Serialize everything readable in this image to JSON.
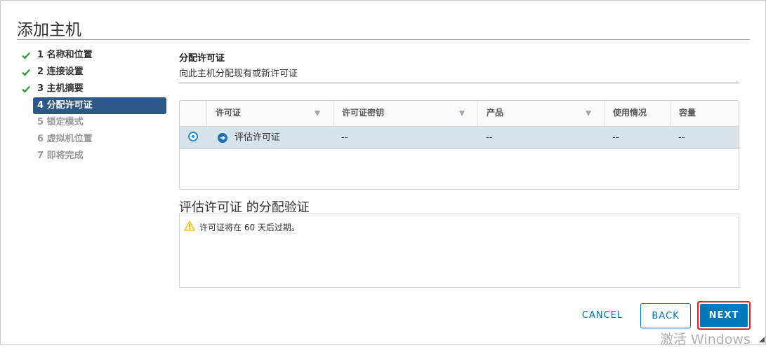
{
  "dialog": {
    "title": "添加主机"
  },
  "steps": [
    {
      "label": "1 名称和位置",
      "state": "done"
    },
    {
      "label": "2 连接设置",
      "state": "done"
    },
    {
      "label": "3 主机摘要",
      "state": "done"
    },
    {
      "label": "4 分配许可证",
      "state": "active"
    },
    {
      "label": "5 锁定模式",
      "state": "future"
    },
    {
      "label": "6 虚拟机位置",
      "state": "future"
    },
    {
      "label": "7 即将完成",
      "state": "future"
    }
  ],
  "section": {
    "title": "分配许可证",
    "description": "向此主机分配现有或新许可证"
  },
  "table": {
    "columns": [
      "许可证",
      "许可证密钥",
      "产品",
      "使用情况",
      "容量"
    ],
    "rows": [
      {
        "license": "评估许可证",
        "key": "--",
        "product": "--",
        "usage": "--",
        "capacity": "--",
        "selected": true
      }
    ]
  },
  "validation": {
    "title": "评估许可证 的分配验证",
    "message": "许可证将在 60 天后过期。"
  },
  "buttons": {
    "cancel": "CANCEL",
    "back": "BACK",
    "next": "NEXT"
  },
  "watermark": "激活 Windows",
  "colors": {
    "accent": "#0079b8",
    "active_step": "#2d5787",
    "check": "#2f9b2f",
    "warning": "#f3c11b",
    "highlight_border": "#e2252b"
  },
  "icons": {
    "done": "check-icon",
    "row": "arrow-right-circle-icon",
    "warning": "warning-icon",
    "filter": "filter-icon"
  }
}
